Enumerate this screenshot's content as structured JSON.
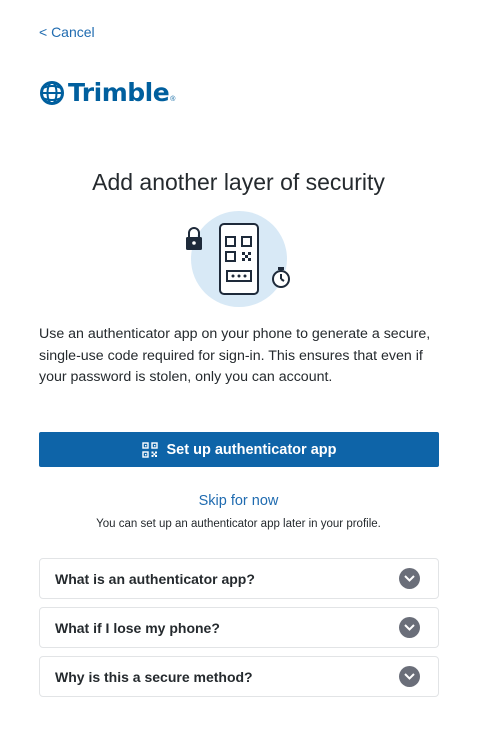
{
  "nav": {
    "cancel_label": "< Cancel"
  },
  "brand": {
    "name": "Trimble",
    "reg_mark": "®",
    "color": "#005f9e"
  },
  "main": {
    "title": "Add another layer of security",
    "description": "Use an authenticator app on your phone to generate a secure, single-use code required for sign-in. This ensures that even if your password is stolen, only you can account.",
    "primary_button_label": "Set up authenticator app",
    "skip_label": "Skip for now",
    "skip_hint": "You can set up an authenticator app later in your profile."
  },
  "faq": {
    "items": [
      {
        "label": "What is an authenticator app?"
      },
      {
        "label": "What if I lose my phone?"
      },
      {
        "label": "Why is this a secure method?"
      }
    ]
  },
  "colors": {
    "accent": "#0e64a8",
    "link": "#1f6bb0",
    "illustration_bg": "#d8e9f6",
    "chevron_bg": "#6a6e79"
  },
  "icons": {
    "primary_button": "qr-code-icon",
    "faq_toggle": "chevron-down-icon",
    "illustration": [
      "lock-icon",
      "phone-qr-icon",
      "stopwatch-icon"
    ]
  }
}
